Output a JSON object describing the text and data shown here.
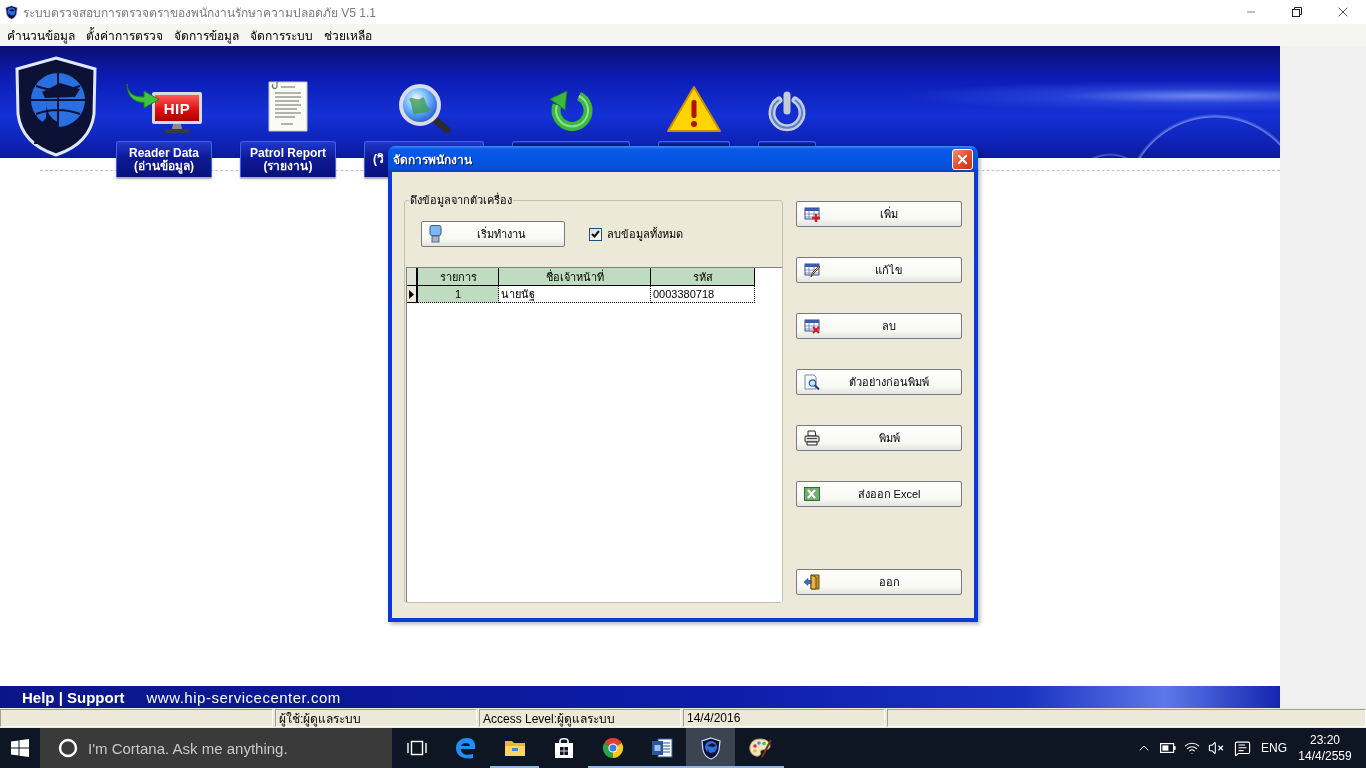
{
  "window": {
    "title": "ระบบตรวจสอบการตรวจตราของพนักงานรักษาความปลอดภัย V5 1.1"
  },
  "menu": [
    "คำนวนข้อมูล",
    "ตั้งค่าการตรวจ",
    "จัดการข้อมูล",
    "จัดการระบบ",
    "ช่วยเหลือ"
  ],
  "banner": {
    "tools": [
      {
        "kind": "reader",
        "icon_text": "HIP",
        "label_lines": [
          "Reader Data",
          "(อ่านข้อมูล)"
        ]
      },
      {
        "kind": "report",
        "label_lines": [
          "Patrol Report",
          "(รายงาน)"
        ]
      },
      {
        "kind": "search",
        "label_lines": [
          "(วิ"
        ]
      },
      {
        "kind": "refresh"
      },
      {
        "kind": "warning"
      },
      {
        "kind": "power"
      }
    ]
  },
  "dialog": {
    "title": "จัดการพนักงาน",
    "group_title": "ดึงข้อมูลจากตัวเครื่อง",
    "start_button": "เริ่มทำงาน",
    "delete_all": {
      "label": "ลบข้อมูลทั้งหมด",
      "checked": true
    },
    "table": {
      "columns": [
        "รายการ",
        "ชื่อเจ้าหน้าที่",
        "รหัส"
      ],
      "rows": [
        {
          "cells": [
            "1",
            "นายนัฐ",
            "0003380718"
          ],
          "selected": true
        }
      ]
    },
    "buttons": [
      {
        "kind": "add",
        "label": "เพิ่ม"
      },
      {
        "kind": "edit",
        "label": "แก้ไข"
      },
      {
        "kind": "delete",
        "label": "ลบ"
      },
      {
        "kind": "preview",
        "label": "ตัวอย่างก่อนพิมพ์"
      },
      {
        "kind": "print",
        "label": "พิมพ์"
      },
      {
        "kind": "excel",
        "label": "ส่งออก Excel"
      },
      {
        "kind": "exit",
        "label": "ออก"
      }
    ]
  },
  "footer": {
    "help": "Help | Support",
    "website": "www.hip-servicecenter.com"
  },
  "status_bar": {
    "user": "ผู้ใช้:ผู้ดูแลระบบ",
    "access_level": "Access Level:ผู้ดูแลระบบ",
    "date": "14/4/2016"
  },
  "taskbar": {
    "search_placeholder": "I'm Cortana. Ask me anything.",
    "apps": [
      {
        "kind": "task_view",
        "running": false,
        "active": false
      },
      {
        "kind": "e_browser",
        "running": false,
        "active": false
      },
      {
        "kind": "folder",
        "running": true,
        "active": false
      },
      {
        "kind": "store",
        "running": false,
        "active": false
      },
      {
        "kind": "circle_browser",
        "running": true,
        "active": false
      },
      {
        "kind": "word_doc",
        "running": true,
        "active": false
      },
      {
        "kind": "shield_app",
        "running": true,
        "active": true
      },
      {
        "kind": "paint",
        "running": true,
        "active": false
      }
    ],
    "language": "ENG",
    "time": "23:20",
    "date": "14/4/2559"
  }
}
